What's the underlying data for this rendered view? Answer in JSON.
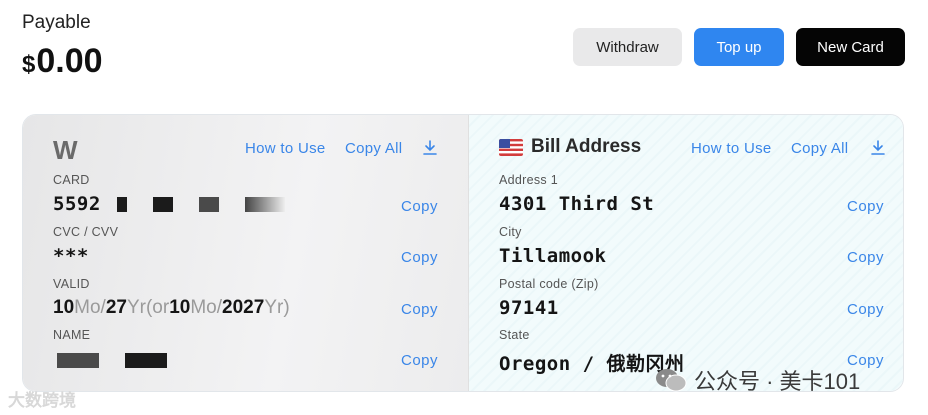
{
  "balance": {
    "label": "Payable",
    "currency": "$",
    "amount": "0.00"
  },
  "actions": {
    "withdraw": "Withdraw",
    "top_up": "Top up",
    "new_card": "New Card"
  },
  "card_panel": {
    "logo": "W",
    "how_to_use": "How to Use",
    "copy_all": "Copy All",
    "card_label": "CARD",
    "card_number_prefix": "5592",
    "cvc_label": "CVC / CVV",
    "cvc_value": "***",
    "valid_label": "VALID",
    "valid": {
      "m1": "10",
      "mo": "Mo",
      "sep": "/",
      "y1": "27",
      "yr": "Yr",
      "or": "(or",
      "m2": "10",
      "y2": "2027",
      "close": ")"
    },
    "name_label": "NAME",
    "copy": "Copy"
  },
  "bill_panel": {
    "title": "Bill Address",
    "how_to_use": "How to Use",
    "copy_all": "Copy All",
    "address1_label": "Address 1",
    "address1_value": "4301 Third St",
    "city_label": "City",
    "city_value": "Tillamook",
    "zip_label": "Postal code (Zip)",
    "zip_value": "97141",
    "state_label": "State",
    "state_value": "Oregon / 俄勒冈州",
    "copy": "Copy"
  },
  "watermarks": {
    "left": "大数跨境",
    "right": "公众号 · 美卡101"
  },
  "colors": {
    "accent": "#2f86f0",
    "link": "#3a86e8",
    "dark_button": "#050505"
  }
}
